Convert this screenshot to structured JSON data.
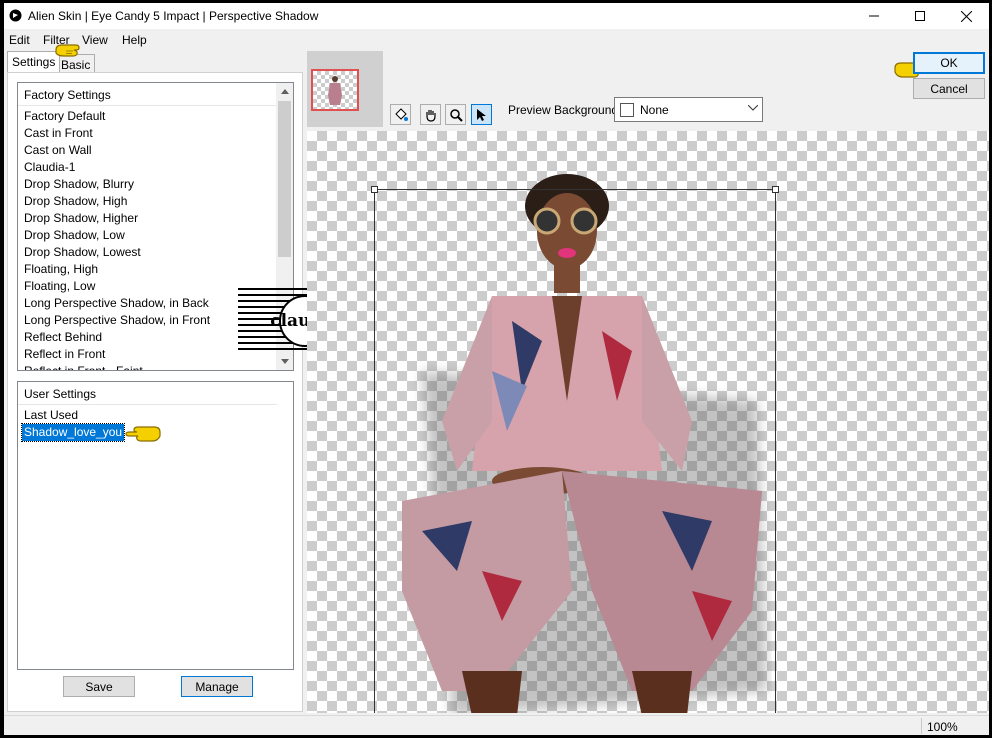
{
  "window": {
    "title": "Alien Skin | Eye Candy 5 Impact | Perspective Shadow"
  },
  "menu": [
    "Edit",
    "Filter",
    "View",
    "Help"
  ],
  "tabs": {
    "settings": "Settings",
    "basic": "Basic"
  },
  "factory": {
    "header": "Factory Settings",
    "items": [
      "Factory Default",
      "Cast in Front",
      "Cast on Wall",
      "Claudia-1",
      "Drop Shadow, Blurry",
      "Drop Shadow, High",
      "Drop Shadow, Higher",
      "Drop Shadow, Low",
      "Drop Shadow, Lowest",
      "Floating, High",
      "Floating, Low",
      "Long Perspective Shadow, in Back",
      "Long Perspective Shadow, in Front",
      "Reflect Behind",
      "Reflect in Front",
      "Reflect in Front - Faint"
    ]
  },
  "user": {
    "header": "User Settings",
    "items": [
      "Last Used",
      "Shadow_love_you"
    ],
    "selected": "Shadow_love_you"
  },
  "buttons": {
    "save": "Save",
    "manage": "Manage",
    "ok": "OK",
    "cancel": "Cancel"
  },
  "preview_background": {
    "label": "Preview Background:",
    "value": "None"
  },
  "tools": [
    "bucket-icon",
    "hand-icon",
    "zoom-icon",
    "arrow-pointer-icon"
  ],
  "watermark": {
    "text": "claudia"
  },
  "status": {
    "zoom": "100%"
  },
  "colors": {
    "accent": "#0078d7",
    "selection": "#0078d7",
    "thumb_border": "#e05050"
  }
}
